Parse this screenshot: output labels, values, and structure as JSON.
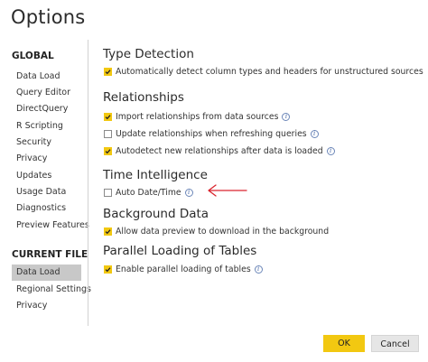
{
  "dialog": {
    "title": "Options"
  },
  "nav": {
    "global_header": "GLOBAL",
    "global_items": [
      "Data Load",
      "Query Editor",
      "DirectQuery",
      "R Scripting",
      "Security",
      "Privacy",
      "Updates",
      "Usage Data",
      "Diagnostics",
      "Preview Features"
    ],
    "current_header": "CURRENT FILE",
    "current_items": [
      "Data Load",
      "Regional Settings",
      "Privacy"
    ],
    "selected": "Data Load"
  },
  "sections": {
    "type_detection": {
      "title": "Type Detection",
      "auto_detect": {
        "label": "Automatically detect column types and headers for unstructured sources",
        "checked": true
      }
    },
    "relationships": {
      "title": "Relationships",
      "import": {
        "label": "Import relationships from data sources",
        "checked": true,
        "info": "i"
      },
      "update": {
        "label": "Update relationships when refreshing queries",
        "checked": false,
        "info": "i"
      },
      "autodetect": {
        "label": "Autodetect new relationships after data is loaded",
        "checked": true,
        "info": "i"
      }
    },
    "time_intelligence": {
      "title": "Time Intelligence",
      "auto_date": {
        "label": "Auto Date/Time",
        "checked": false,
        "info": "i"
      }
    },
    "background_data": {
      "title": "Background Data",
      "preview": {
        "label": "Allow data preview to download in the background",
        "checked": true
      }
    },
    "parallel_loading": {
      "title": "Parallel Loading of Tables",
      "enable": {
        "label": "Enable parallel loading of tables",
        "checked": true,
        "info": "i"
      }
    }
  },
  "footer": {
    "ok_label": "OK",
    "cancel_label": "Cancel"
  },
  "colors": {
    "accent": "#f2c811",
    "annotation_arrow": "#d9232d",
    "selected_nav": "#c8c8c8"
  },
  "icons": {
    "checkmark": "checkmark-icon",
    "info": "info-icon",
    "annotation": "red-arrow-annotation"
  }
}
